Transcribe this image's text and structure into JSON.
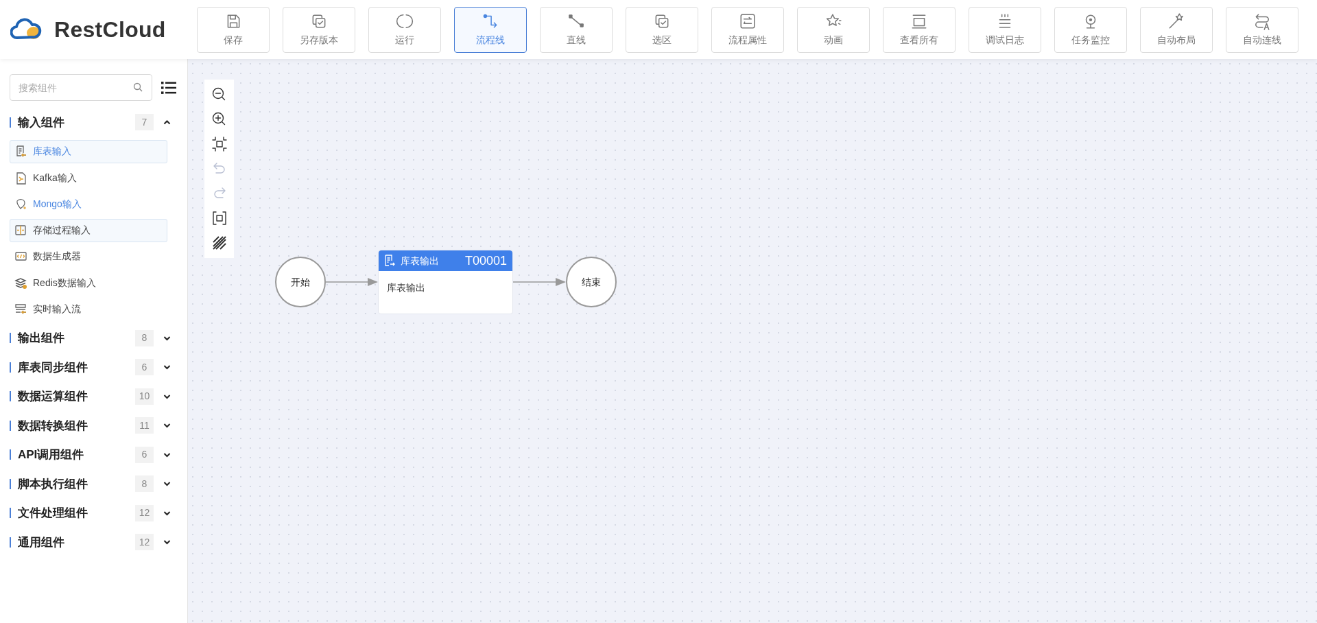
{
  "logo": {
    "text": "RestCloud"
  },
  "toolbar": [
    {
      "label": "保存",
      "selected": false
    },
    {
      "label": "另存版本",
      "selected": false
    },
    {
      "label": "运行",
      "selected": false
    },
    {
      "label": "流程线",
      "selected": true
    },
    {
      "label": "直线",
      "selected": false
    },
    {
      "label": "选区",
      "selected": false
    },
    {
      "label": "流程属性",
      "selected": false
    },
    {
      "label": "动画",
      "selected": false
    },
    {
      "label": "查看所有",
      "selected": false
    },
    {
      "label": "调试日志",
      "selected": false
    },
    {
      "label": "任务监控",
      "selected": false
    },
    {
      "label": "自动布局",
      "selected": false
    },
    {
      "label": "自动连线",
      "selected": false
    }
  ],
  "sidebar": {
    "search": {
      "placeholder": "搜索组件"
    },
    "groups": [
      {
        "title": "输入组件",
        "count": "7",
        "expanded": true,
        "items": [
          {
            "label": "库表输入",
            "highlighted": true,
            "outlined": true
          },
          {
            "label": "Kafka输入",
            "highlighted": false,
            "outlined": false
          },
          {
            "label": "Mongo输入",
            "highlighted": true,
            "outlined": false
          },
          {
            "label": "存储过程输入",
            "highlighted": false,
            "outlined": true
          },
          {
            "label": "数据生成器",
            "highlighted": false,
            "outlined": false
          },
          {
            "label": "Redis数据输入",
            "highlighted": false,
            "outlined": false
          },
          {
            "label": "实时输入流",
            "highlighted": false,
            "outlined": false
          }
        ]
      },
      {
        "title": "输出组件",
        "count": "8",
        "expanded": false
      },
      {
        "title": "库表同步组件",
        "count": "6",
        "expanded": false
      },
      {
        "title": "数据运算组件",
        "count": "10",
        "expanded": false
      },
      {
        "title": "数据转换组件",
        "count": "11",
        "expanded": false
      },
      {
        "title": "API调用组件",
        "count": "6",
        "expanded": false
      },
      {
        "title": "脚本执行组件",
        "count": "8",
        "expanded": false
      },
      {
        "title": "文件处理组件",
        "count": "12",
        "expanded": false
      },
      {
        "title": "通用组件",
        "count": "12",
        "expanded": false
      }
    ]
  },
  "canvas": {
    "tools": [
      {
        "disabled": false
      },
      {
        "disabled": false
      },
      {
        "disabled": false
      },
      {
        "disabled": true
      },
      {
        "disabled": true
      },
      {
        "disabled": false
      },
      {
        "disabled": false
      }
    ],
    "nodes": [
      {
        "kind": "start",
        "label": "开始"
      },
      {
        "kind": "task",
        "title": "库表输出",
        "code": "T00001",
        "body": "库表输出"
      },
      {
        "kind": "end",
        "label": "结束"
      }
    ]
  }
}
